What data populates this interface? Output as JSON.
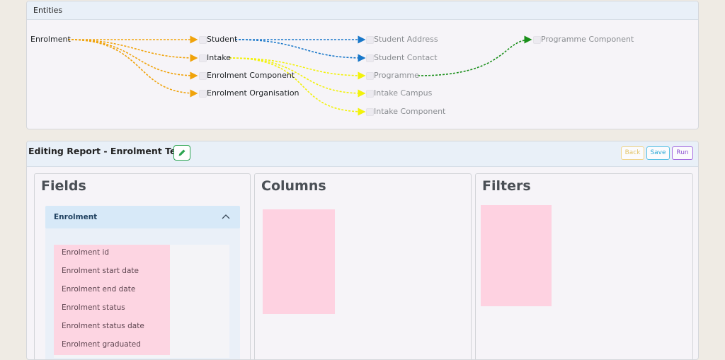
{
  "entities": {
    "title": "Entities",
    "root": "Enrolment",
    "level1": [
      "Student",
      "Intake",
      "Enrolment Component",
      "Enrolment Organisation"
    ],
    "level2": [
      "Student Address",
      "Student Contact",
      "Programme",
      "Intake Campus",
      "Intake Component"
    ],
    "level3": [
      "Programme Component"
    ],
    "edge_colors": {
      "enrolment": "#f0a30a",
      "student": "#1877c9",
      "intake": "#f2f20a",
      "programme": "#1a8f1a"
    }
  },
  "report": {
    "title": "Editing Report - Enrolment Test",
    "buttons": {
      "back": "Back",
      "save": "Save",
      "run": "Run"
    }
  },
  "fields": {
    "heading": "Fields",
    "group": "Enrolment",
    "items": [
      "Enrolment id",
      "Enrolment start date",
      "Enrolment end date",
      "Enrolment status",
      "Enrolment status date",
      "Enrolment graduated"
    ]
  },
  "columns": {
    "heading": "Columns"
  },
  "filters": {
    "heading": "Filters"
  }
}
